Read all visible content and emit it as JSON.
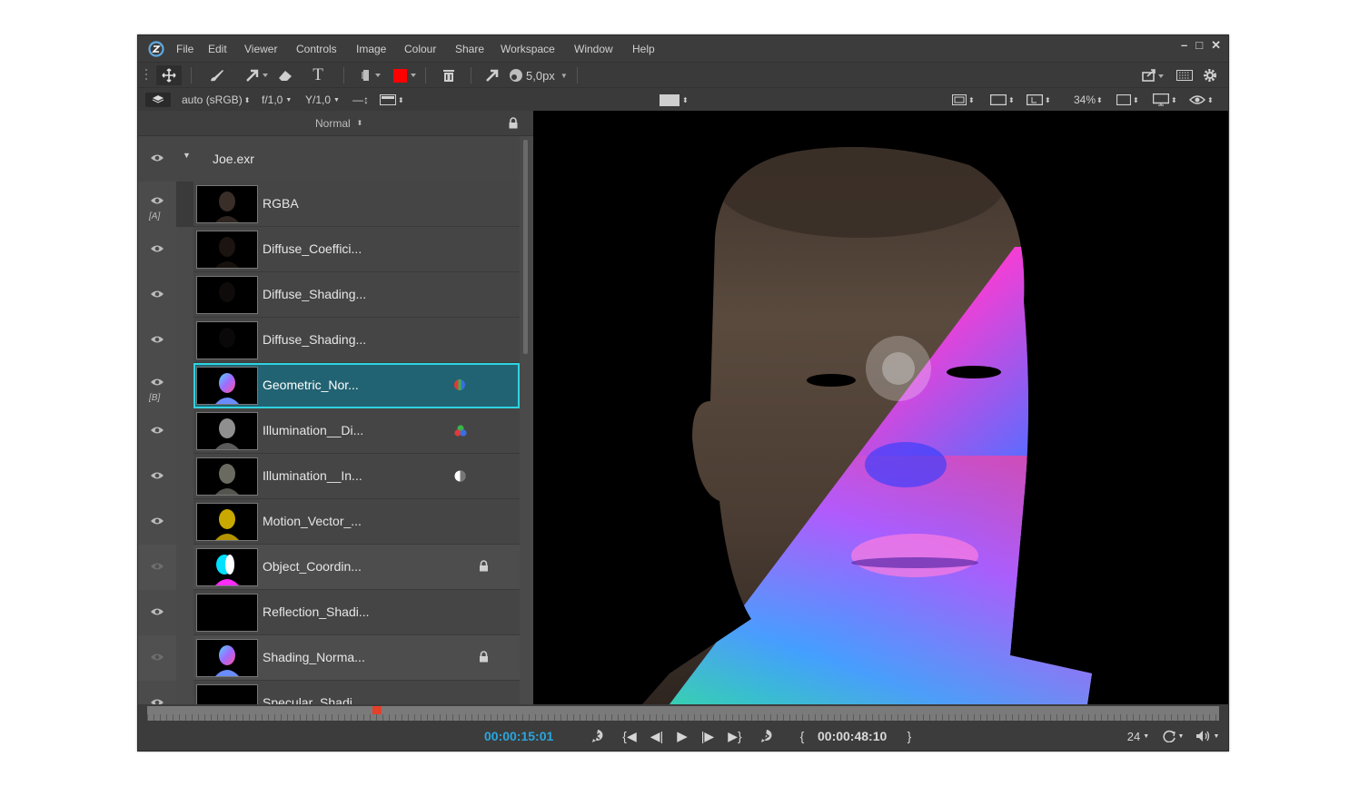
{
  "menu": [
    "File",
    "Edit",
    "Viewer",
    "Controls",
    "Image",
    "Colour",
    "Share",
    "Workspace",
    "Window",
    "Help"
  ],
  "window_controls": {
    "minimize": "–",
    "maximize": "□",
    "close": "✕"
  },
  "toolbar": {
    "brush_size": "5,0px",
    "brush_color": "#ff0000"
  },
  "options": {
    "colorspace": "auto (sRGB)",
    "fstop": "f/1,0",
    "gamma": "Y/1,0",
    "zoom": "34%"
  },
  "layer_panel": {
    "blend_mode": "Normal",
    "root": "Joe.exr",
    "layers": [
      {
        "name": "RGBA",
        "tag": "[A]",
        "thumb": "dark"
      },
      {
        "name": "Diffuse_Coeffici...",
        "tag": "",
        "thumb": "darker"
      },
      {
        "name": "Diffuse_Shading...",
        "tag": "",
        "thumb": "darkest"
      },
      {
        "name": "Diffuse_Shading...",
        "tag": "",
        "thumb": "darkest"
      },
      {
        "name": "Geometric_Nor...",
        "tag": "[B]",
        "thumb": "normal",
        "selected": true,
        "badge": "rgb-channels-icon"
      },
      {
        "name": "Illumination__Di...",
        "tag": "",
        "thumb": "gray",
        "badge": "rgb-dots-icon"
      },
      {
        "name": "Illumination__In...",
        "tag": "",
        "thumb": "gray2",
        "badge": "half-circle-icon"
      },
      {
        "name": "Motion_Vector_...",
        "tag": "",
        "thumb": "yellow"
      },
      {
        "name": "Object_Coordin...",
        "tag": "",
        "thumb": "object",
        "locked": true
      },
      {
        "name": "Reflection_Shadi...",
        "tag": "",
        "thumb": "black"
      },
      {
        "name": "Shading_Norma...",
        "tag": "",
        "thumb": "normal",
        "locked": true
      },
      {
        "name": "Specular_Shadi...",
        "tag": "",
        "thumb": "black"
      }
    ]
  },
  "timeline": {
    "current_time": "00:00:15:01",
    "duration": "00:00:48:10",
    "fps": "24",
    "playhead_fraction": 0.21,
    "accent_color": "#2aa6de"
  }
}
